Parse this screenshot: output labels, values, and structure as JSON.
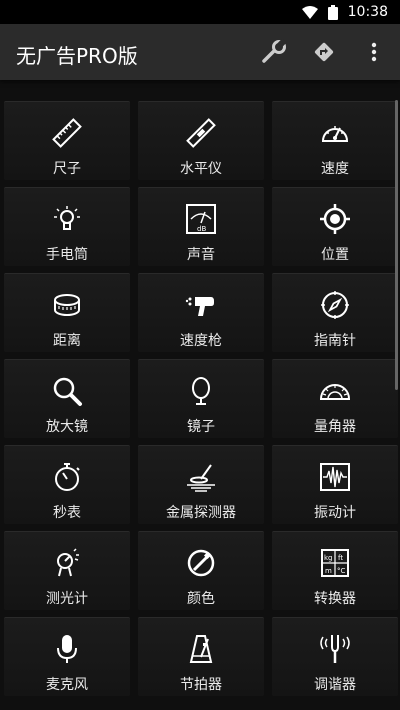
{
  "status": {
    "time": "10:38"
  },
  "app": {
    "title": "无广告PRO版"
  },
  "toolbar": {
    "actions": [
      "wrench-icon",
      "navigation-icon",
      "more-vert-icon"
    ]
  },
  "tools": [
    {
      "label": "尺子",
      "icon": "ruler-icon"
    },
    {
      "label": "水平仪",
      "icon": "level-icon"
    },
    {
      "label": "速度",
      "icon": "speedometer-icon"
    },
    {
      "label": "手电筒",
      "icon": "flashlight-icon"
    },
    {
      "label": "声音",
      "icon": "decibel-icon"
    },
    {
      "label": "位置",
      "icon": "gps-target-icon"
    },
    {
      "label": "距离",
      "icon": "tape-measure-icon"
    },
    {
      "label": "速度枪",
      "icon": "speed-gun-icon"
    },
    {
      "label": "指南针",
      "icon": "compass-icon"
    },
    {
      "label": "放大镜",
      "icon": "magnifier-icon"
    },
    {
      "label": "镜子",
      "icon": "mirror-icon"
    },
    {
      "label": "量角器",
      "icon": "protractor-icon"
    },
    {
      "label": "秒表",
      "icon": "stopwatch-icon"
    },
    {
      "label": "金属探测器",
      "icon": "metal-detector-icon"
    },
    {
      "label": "振动计",
      "icon": "vibration-icon"
    },
    {
      "label": "测光计",
      "icon": "light-meter-icon"
    },
    {
      "label": "颜色",
      "icon": "color-picker-icon"
    },
    {
      "label": "转换器",
      "icon": "converter-icon"
    },
    {
      "label": "麦克风",
      "icon": "microphone-icon"
    },
    {
      "label": "节拍器",
      "icon": "metronome-icon"
    },
    {
      "label": "调谐器",
      "icon": "tuner-icon"
    }
  ],
  "colors": {
    "background": "#0f0f0f",
    "appbar": "#2b2b2b",
    "tile": "#1c1c1c",
    "icon": "#ffffff"
  }
}
